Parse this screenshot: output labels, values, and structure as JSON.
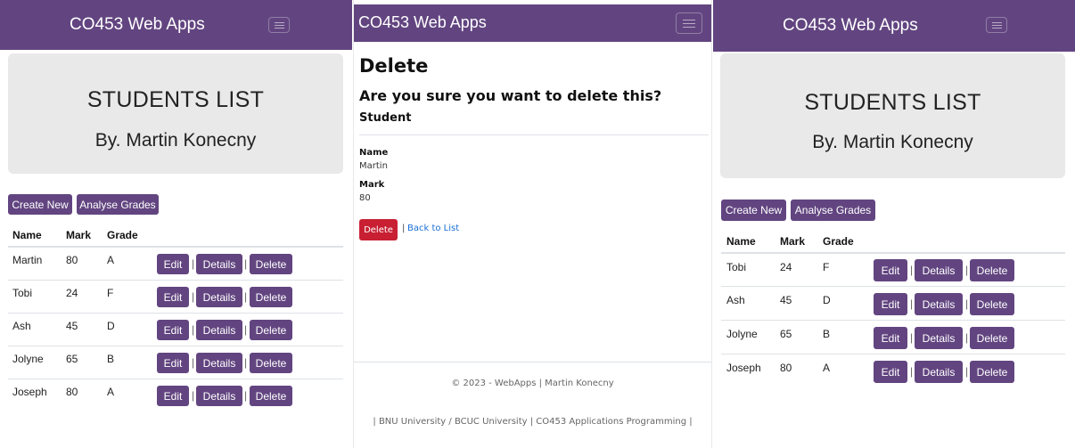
{
  "theme": {
    "primary": "#624580",
    "danger": "#c81f32",
    "link": "#1a6fd6",
    "jumbotron": "#e9e9e9"
  },
  "left": {
    "brand": "CO453 Web Apps",
    "title": "STUDENTS LIST",
    "subtitle": "By. Martin Konecny",
    "create_label": "Create New",
    "analyse_label": "Analyse Grades",
    "columns": [
      "Name",
      "Mark",
      "Grade"
    ],
    "rows": [
      {
        "name": "Martin",
        "mark": "80",
        "grade": "A"
      },
      {
        "name": "Tobi",
        "mark": "24",
        "grade": "F"
      },
      {
        "name": "Ash",
        "mark": "45",
        "grade": "D"
      },
      {
        "name": "Jolyne",
        "mark": "65",
        "grade": "B"
      },
      {
        "name": "Joseph",
        "mark": "80",
        "grade": "A"
      }
    ],
    "edit_label": "Edit",
    "details_label": "Details",
    "delete_label": "Delete",
    "separator": "|"
  },
  "mid": {
    "brand": "CO453 Web Apps",
    "heading": "Delete",
    "question": "Are you sure you want to delete this?",
    "entity": "Student",
    "name_label": "Name",
    "name_value": "Martin",
    "mark_label": "Mark",
    "mark_value": "80",
    "delete_label": "Delete",
    "separator": "|",
    "back_label": "Back to List",
    "footer_copyright": "© 2023 - WebApps | Martin Konecny",
    "footer_links": "| BNU University / BCUC University | CO453 Applications Programming |"
  },
  "right": {
    "brand": "CO453 Web Apps",
    "title": "STUDENTS LIST",
    "subtitle": "By. Martin Konecny",
    "create_label": "Create New",
    "analyse_label": "Analyse Grades",
    "columns": [
      "Name",
      "Mark",
      "Grade"
    ],
    "rows": [
      {
        "name": "Tobi",
        "mark": "24",
        "grade": "F"
      },
      {
        "name": "Ash",
        "mark": "45",
        "grade": "D"
      },
      {
        "name": "Jolyne",
        "mark": "65",
        "grade": "B"
      },
      {
        "name": "Joseph",
        "mark": "80",
        "grade": "A"
      }
    ],
    "edit_label": "Edit",
    "details_label": "Details",
    "delete_label": "Delete",
    "separator": "|"
  }
}
